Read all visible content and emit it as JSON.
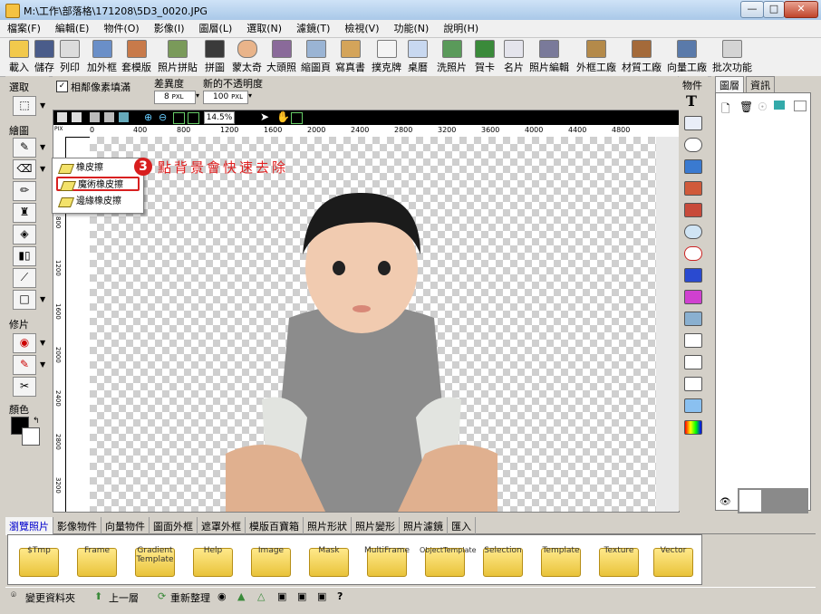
{
  "window": {
    "title": "M:\\工作\\部落格\\171208\\5D3_0020.JPG",
    "controls": [
      "—",
      "□",
      "✕"
    ]
  },
  "menu": [
    "檔案(F)",
    "編輯(E)",
    "物件(O)",
    "影像(I)",
    "圖層(L)",
    "選取(N)",
    "濾鏡(T)",
    "檢視(V)",
    "功能(N)",
    "說明(H)"
  ],
  "toolbar": [
    "載入",
    "儲存",
    "列印",
    "加外框",
    "套模版",
    "照片拼貼",
    "拼圖",
    "蒙太奇",
    "大頭照",
    "縮圖頁",
    "寫真書",
    "撲克牌",
    "桌曆",
    "洗照片",
    "賀卡",
    "名片",
    "照片編輯",
    "外框工廠",
    "材質工廠",
    "向量工廠",
    "批次功能"
  ],
  "left_panel": {
    "select_label": "選取",
    "draw_label": "繪圖",
    "retouch_label": "修片",
    "color_label": "顏色"
  },
  "options_bar": {
    "adjacent_fill_label": "相鄰像素填滿",
    "adjacent_checked": true,
    "tolerance_label": "差異度",
    "tolerance_value": "8",
    "tolerance_unit": "PXL",
    "opacity_label": "新的不透明度",
    "opacity_value": "100",
    "opacity_unit": "PXL"
  },
  "view": {
    "zoom": "14.5%",
    "ruler_unit": "PIX",
    "h_ticks": [
      "0",
      "400",
      "800",
      "1200",
      "1600",
      "2000",
      "2400",
      "2800",
      "3200",
      "3600",
      "4000",
      "4400",
      "4800"
    ],
    "v_ticks": [
      "400",
      "800",
      "1200",
      "1600",
      "2000",
      "2400",
      "2800",
      "3200"
    ]
  },
  "popup": {
    "items": [
      "橡皮擦",
      "魔術橡皮擦",
      "邊緣橡皮擦"
    ],
    "highlighted_index": 1
  },
  "annotation": {
    "number": "3",
    "text": "點背景會快速去除",
    "color": "#e02020"
  },
  "right_column_label": "物件",
  "right_panel": {
    "tabs": [
      "圖層",
      "資訊"
    ]
  },
  "bottom_tabs": [
    "瀏覽照片",
    "影像物件",
    "向量物件",
    "圖面外框",
    "遮罩外框",
    "模版百寶箱",
    "照片形狀",
    "照片變形",
    "照片濾鏡",
    "匯入"
  ],
  "bottom_active_tab": 0,
  "folders": [
    "$Tmp",
    "Frame",
    "Gradient Template",
    "Help",
    "Image",
    "Mask",
    "MultiFrame",
    "ObjectTemplate",
    "Selection",
    "Template",
    "Texture",
    "Vector"
  ],
  "status_bar": {
    "change_folder": "變更資料夾",
    "up_level": "上一層",
    "refresh": "重新整理"
  }
}
